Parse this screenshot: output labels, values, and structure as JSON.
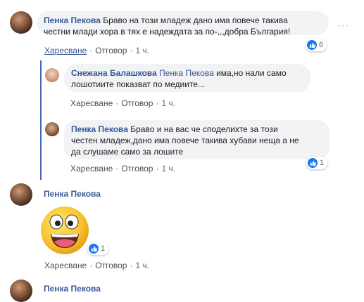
{
  "comment1": {
    "author": "Пенка Пекова",
    "text_line1": "Браво на този младеж дано има повече такива",
    "text_line2": "честни млади хора в тях е надеждата за по-,,,добра България!",
    "reactions": "6",
    "like": "Харесване",
    "reply": "Отговор",
    "time": "1 ч."
  },
  "reply1": {
    "author": "Снежана Балашкова",
    "mention": "Пенка Пекова",
    "text_line1": " има,но нали само",
    "text_line2": "лошотиите показват по медиите...",
    "like": "Харесване",
    "reply": "Отговор",
    "time": "1 ч."
  },
  "reply2": {
    "author": "Пенка Пекова",
    "text_line1": "Браво и на вас че споделихте за този",
    "text_line2": "честен младеж,дано има повече такива хубави неща а не",
    "text_line3": "да слушаме само за лошите",
    "reactions": "1",
    "like": "Харесване",
    "reply": "Отговор",
    "time": "1 ч."
  },
  "comment2": {
    "author": "Пенка Пекова",
    "sticker": "smiley-face-emoji",
    "reactions": "1",
    "like": "Харесване",
    "reply": "Отговор",
    "time": "1 ч."
  },
  "comment3": {
    "author": "Пенка Пекова"
  },
  "icons": {
    "more": "more-options-icon",
    "like": "like-thumb-icon"
  },
  "colors": {
    "link": "#385898",
    "like": "#1877f2",
    "bubble": "#f2f3f5"
  }
}
